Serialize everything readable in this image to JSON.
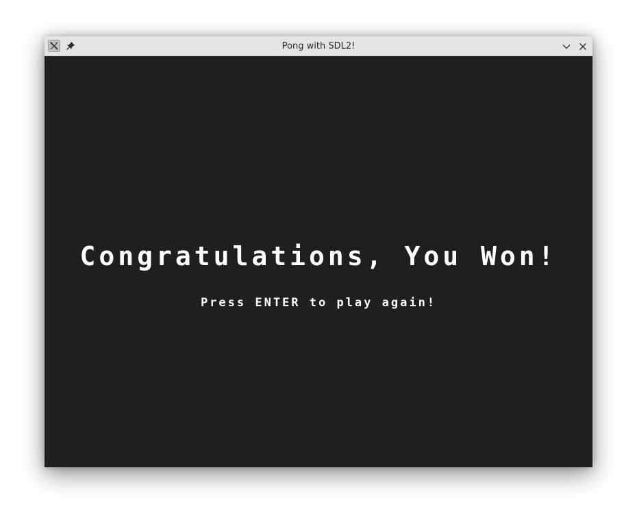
{
  "window": {
    "title": "Pong with SDL2!",
    "app_icon": "x-app-icon",
    "pin_icon": "pin-icon",
    "minimize_icon": "chevron-down-icon",
    "close_icon": "close-icon",
    "background_color": "#1f1f1f",
    "titlebar_color": "#e3e4e6"
  },
  "game": {
    "headline": "Congratulations, You Won!",
    "prompt": "Press ENTER to play again!",
    "text_color": "#ffffff"
  }
}
